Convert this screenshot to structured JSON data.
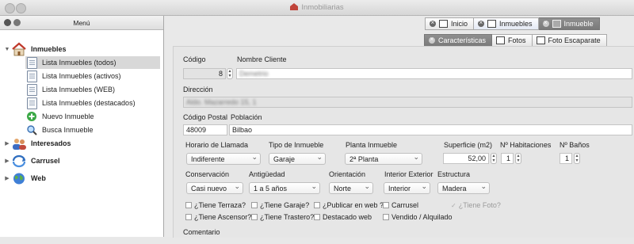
{
  "window": {
    "title": "Inmobiliarias"
  },
  "sidebar": {
    "title": "Menú",
    "items": [
      {
        "label": "Inmuebles",
        "icon": "house-icon"
      },
      {
        "label": "Lista Inmuebles (todos)",
        "icon": "document-icon"
      },
      {
        "label": "Lista Inmuebles (activos)",
        "icon": "document-icon"
      },
      {
        "label": "Lista Inmuebles (WEB)",
        "icon": "document-icon"
      },
      {
        "label": "Lista Inmuebles (destacados)",
        "icon": "document-icon"
      },
      {
        "label": "Nuevo Inmueble",
        "icon": "add-icon"
      },
      {
        "label": "Busca Inmueble",
        "icon": "search-icon"
      },
      {
        "label": "Interesados",
        "icon": "people-icon"
      },
      {
        "label": "Carrusel",
        "icon": "carousel-icon"
      },
      {
        "label": "Web",
        "icon": "globe-icon"
      }
    ]
  },
  "tabs": {
    "t1": "Inicio",
    "t2": "Inmuebles",
    "t3": "Inmueble"
  },
  "subtabs": {
    "s1": "Características",
    "s2": "Fotos",
    "s3": "Foto Escaparate"
  },
  "form": {
    "codigo_label": "Código",
    "codigo": "8",
    "cliente_label": "Nombre Cliente",
    "cliente": "Demetrio",
    "direccion_label": "Dirección",
    "direccion": "Aldo. Mazarredo 15, 1",
    "cp_label": "Código Postal",
    "cp": "48009",
    "poblacion_label": "Población",
    "poblacion": "Bilbao",
    "horario_label": "Horario de Llamada",
    "horario": "Indiferente",
    "tipo_label": "Tipo de Inmueble",
    "tipo": "Garaje",
    "planta_label": "Planta Inmueble",
    "planta": "2ª Planta",
    "superficie_label": "Superficie (m2)",
    "superficie": "52,00",
    "habitaciones_label": "Nº Habitaciones",
    "habitaciones": "1",
    "banos_label": "Nº Baños",
    "banos": "1",
    "conservacion_label": "Conservación",
    "conservacion": "Casi nuevo",
    "antiguedad_label": "Antigüedad",
    "antiguedad": "1 a 5 años",
    "orientacion_label": "Orientación",
    "orientacion": "Norte",
    "interior_label": "Interior Exterior",
    "interior": "Interior",
    "estructura_label": "Estructura",
    "estructura": "Madera",
    "chk": {
      "terraza": "¿Tiene Terraza?",
      "garaje": "¿Tiene Garaje?",
      "publicar": "¿Publicar en web ?",
      "carrusel": "Carrusel",
      "foto": "¿Tiene Foto?",
      "ascensor": "¿Tiene Ascensor?",
      "trastero": "¿Tiene Trastero?",
      "destacado": "Destacado web",
      "vendido": "Vendido / Alquilado"
    },
    "comentario_label": "Comentario"
  }
}
